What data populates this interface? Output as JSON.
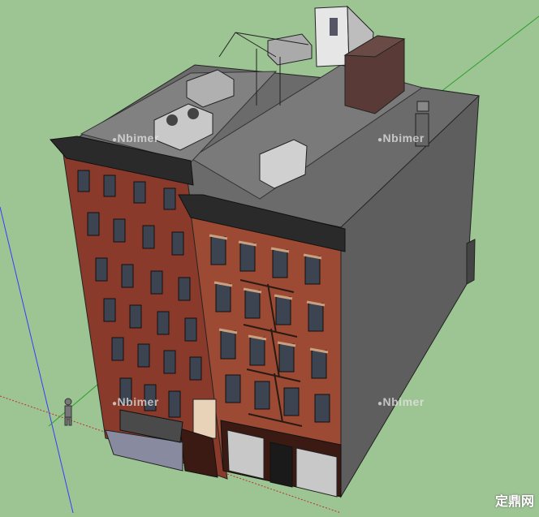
{
  "scene": {
    "sky_color": "#9dc493",
    "watermarks": [
      "Nbimer",
      "Nbimer",
      "Nbimer",
      "Nbimer"
    ],
    "logo": "定鼎网",
    "colors": {
      "brick_tall": "#8a3a2a",
      "brick_short": "#9c4a34",
      "side_wall": "#5e5e5e",
      "roof": "#6b6b6b",
      "trim_dark": "#2a2a2a",
      "window": "#3b4450",
      "lintel": "#c9a080"
    }
  }
}
